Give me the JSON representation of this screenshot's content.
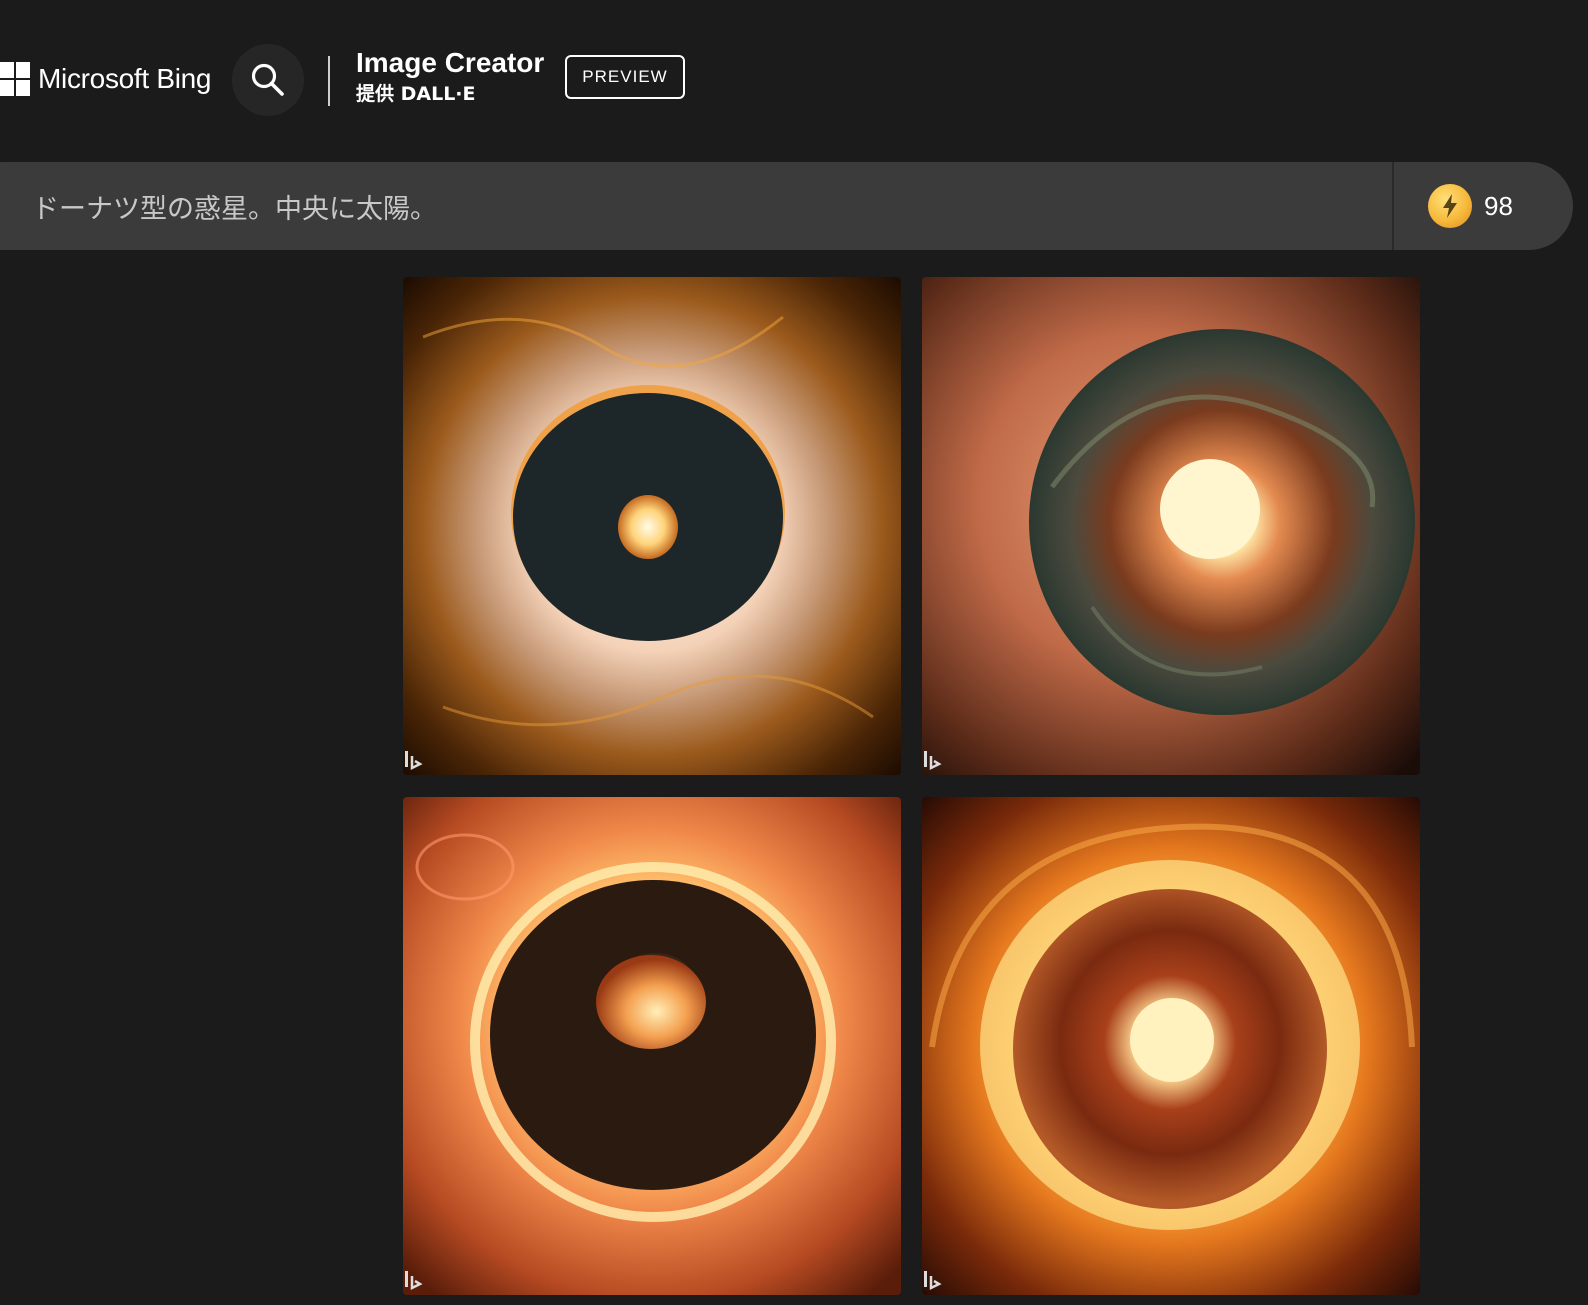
{
  "header": {
    "brand_name": "Microsoft Bing",
    "app_title": "Image Creator",
    "app_subtitle": "提供 DALL·E",
    "preview_label": "PREVIEW",
    "search_icon": "search-icon"
  },
  "prompt": {
    "value": "ドーナツ型の惑星。中央に太陽。",
    "boost_icon": "lightning-coin-icon",
    "boost_count": "98"
  },
  "results": {
    "images": [
      {
        "name": "generated-image-1",
        "watermark_icon": "bing-watermark-icon"
      },
      {
        "name": "generated-image-2",
        "watermark_icon": "bing-watermark-icon"
      },
      {
        "name": "generated-image-3",
        "watermark_icon": "bing-watermark-icon"
      },
      {
        "name": "generated-image-4",
        "watermark_icon": "bing-watermark-icon"
      }
    ]
  },
  "colors": {
    "background": "#1b1b1b",
    "prompt_bar": "#3b3b3b",
    "coin": "#f6b93b"
  }
}
